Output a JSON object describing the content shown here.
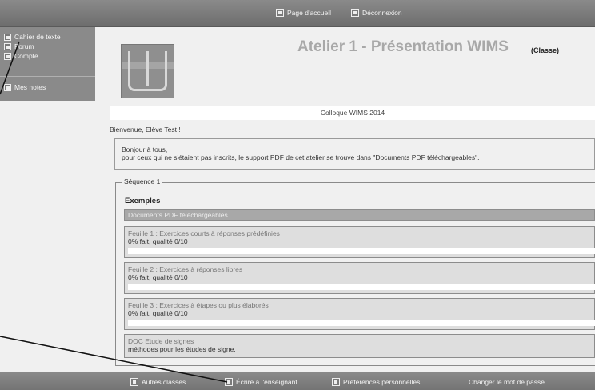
{
  "topbar": {
    "home_label": "Page d'accueil",
    "logout_label": "Déconnexion",
    "home_icon": "home-icon",
    "logout_icon": "logout-icon"
  },
  "sidebar": {
    "items": [
      {
        "label": "Cahier de texte",
        "icon": "notebook-icon"
      },
      {
        "label": "Forum",
        "icon": "forum-icon"
      },
      {
        "label": "Compte",
        "icon": "account-icon"
      },
      {
        "label": "Mes notes",
        "icon": "grades-icon"
      }
    ]
  },
  "header": {
    "title": "Atelier 1 - Présentation WIMS",
    "type_label": "(Classe)"
  },
  "colloque": "Colloque WIMS 2014",
  "welcome": "Bienvenue, Elève Test !",
  "message": {
    "line1": "Bonjour à tous,",
    "line2": "pour ceux qui ne s'étaient pas inscrits, le support PDF de cet atelier se trouve dans \"Documents PDF téléchargeables\"."
  },
  "sequence": {
    "legend": "Séquence 1",
    "heading": "Exemples",
    "docs_label": "Documents PDF téléchargeables",
    "sheets": [
      {
        "name": "Feuille 1 : Exercices courts à réponses prédéfinies",
        "progress": "0% fait, qualité 0/10",
        "fraction": 0
      },
      {
        "name": "Feuille 2 : Exercices à réponses libres",
        "progress": "0% fait, qualité 0/10",
        "fraction": 0
      },
      {
        "name": "Feuille 3 : Exercices à étapes ou plus élaborés",
        "progress": "0% fait, qualité 0/10",
        "fraction": 0
      }
    ],
    "doc_item": {
      "name": "DOC Etude de signes",
      "description": "méthodes pour les études de signe."
    }
  },
  "footer": {
    "items": [
      {
        "label": "Autres classes",
        "icon": "classes-icon"
      },
      {
        "label": "Écrire à l'enseignant",
        "icon": "mail-icon"
      },
      {
        "label": "Préférences personnelles",
        "icon": "preferences-icon"
      },
      {
        "label": "Changer le mot de passe",
        "icon": ""
      }
    ]
  },
  "colors": {
    "bar": "#7a7a7a",
    "background": "#f0f0f0",
    "title": "#a8a8a8"
  }
}
